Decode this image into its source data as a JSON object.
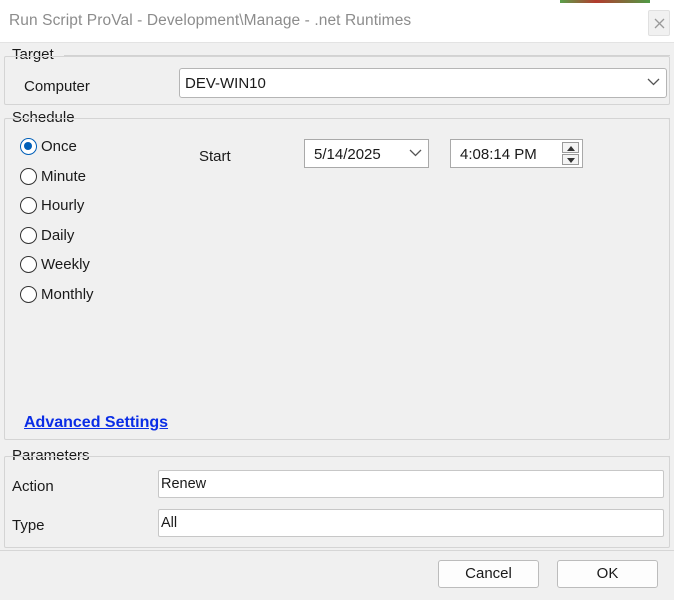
{
  "window": {
    "title": "Run Script ProVal - Development\\Manage - .net Runtimes",
    "close_icon": "close-icon"
  },
  "target": {
    "section_label": "Target",
    "computer_label": "Computer",
    "computer_value": "DEV-WIN10"
  },
  "schedule": {
    "section_label": "Schedule",
    "options": [
      {
        "label": "Once",
        "selected": true
      },
      {
        "label": "Minute",
        "selected": false
      },
      {
        "label": "Hourly",
        "selected": false
      },
      {
        "label": "Daily",
        "selected": false
      },
      {
        "label": "Weekly",
        "selected": false
      },
      {
        "label": "Monthly",
        "selected": false
      }
    ],
    "start_label": "Start",
    "start_date": "5/14/2025",
    "start_time": "4:08:14 PM",
    "advanced_link": "Advanced Settings"
  },
  "parameters": {
    "section_label": "Parameters",
    "action_label": "Action",
    "action_value": "Renew",
    "type_label": "Type",
    "type_value": "All"
  },
  "buttons": {
    "cancel": "Cancel",
    "ok": "OK"
  },
  "colors": {
    "accent": "#005fb8",
    "link": "#0a2de6",
    "background": "#f0f0f0"
  }
}
